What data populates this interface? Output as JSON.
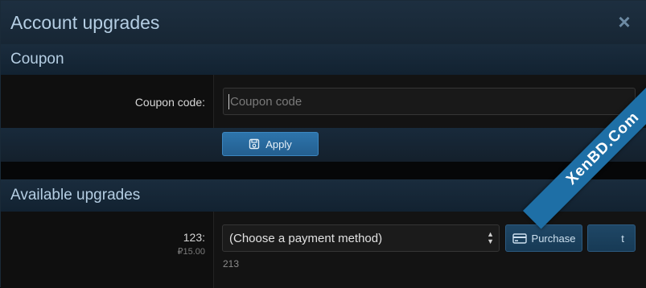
{
  "dialog": {
    "title": "Account upgrades",
    "close_icon": "×"
  },
  "coupon": {
    "section_title": "Coupon",
    "field_label": "Coupon code:",
    "input_value": "",
    "input_placeholder": "Coupon code",
    "apply_label": "Apply",
    "apply_icon": "save-icon"
  },
  "upgrades": {
    "section_title": "Available upgrades",
    "items": [
      {
        "title": "123:",
        "price": "₽15.00",
        "payment_select_value": "(Choose a payment method)",
        "purchase_label": "Purchase",
        "purchase_icon": "credit-card-icon",
        "gift_label": "t",
        "description": "213"
      }
    ]
  },
  "watermark": {
    "text": "XenBD.Com"
  },
  "colors": {
    "accent": "#2d74ab",
    "header_bg": "#1d2f40",
    "title_text": "#b5cee3",
    "ribbon": "#1e6fa6"
  }
}
